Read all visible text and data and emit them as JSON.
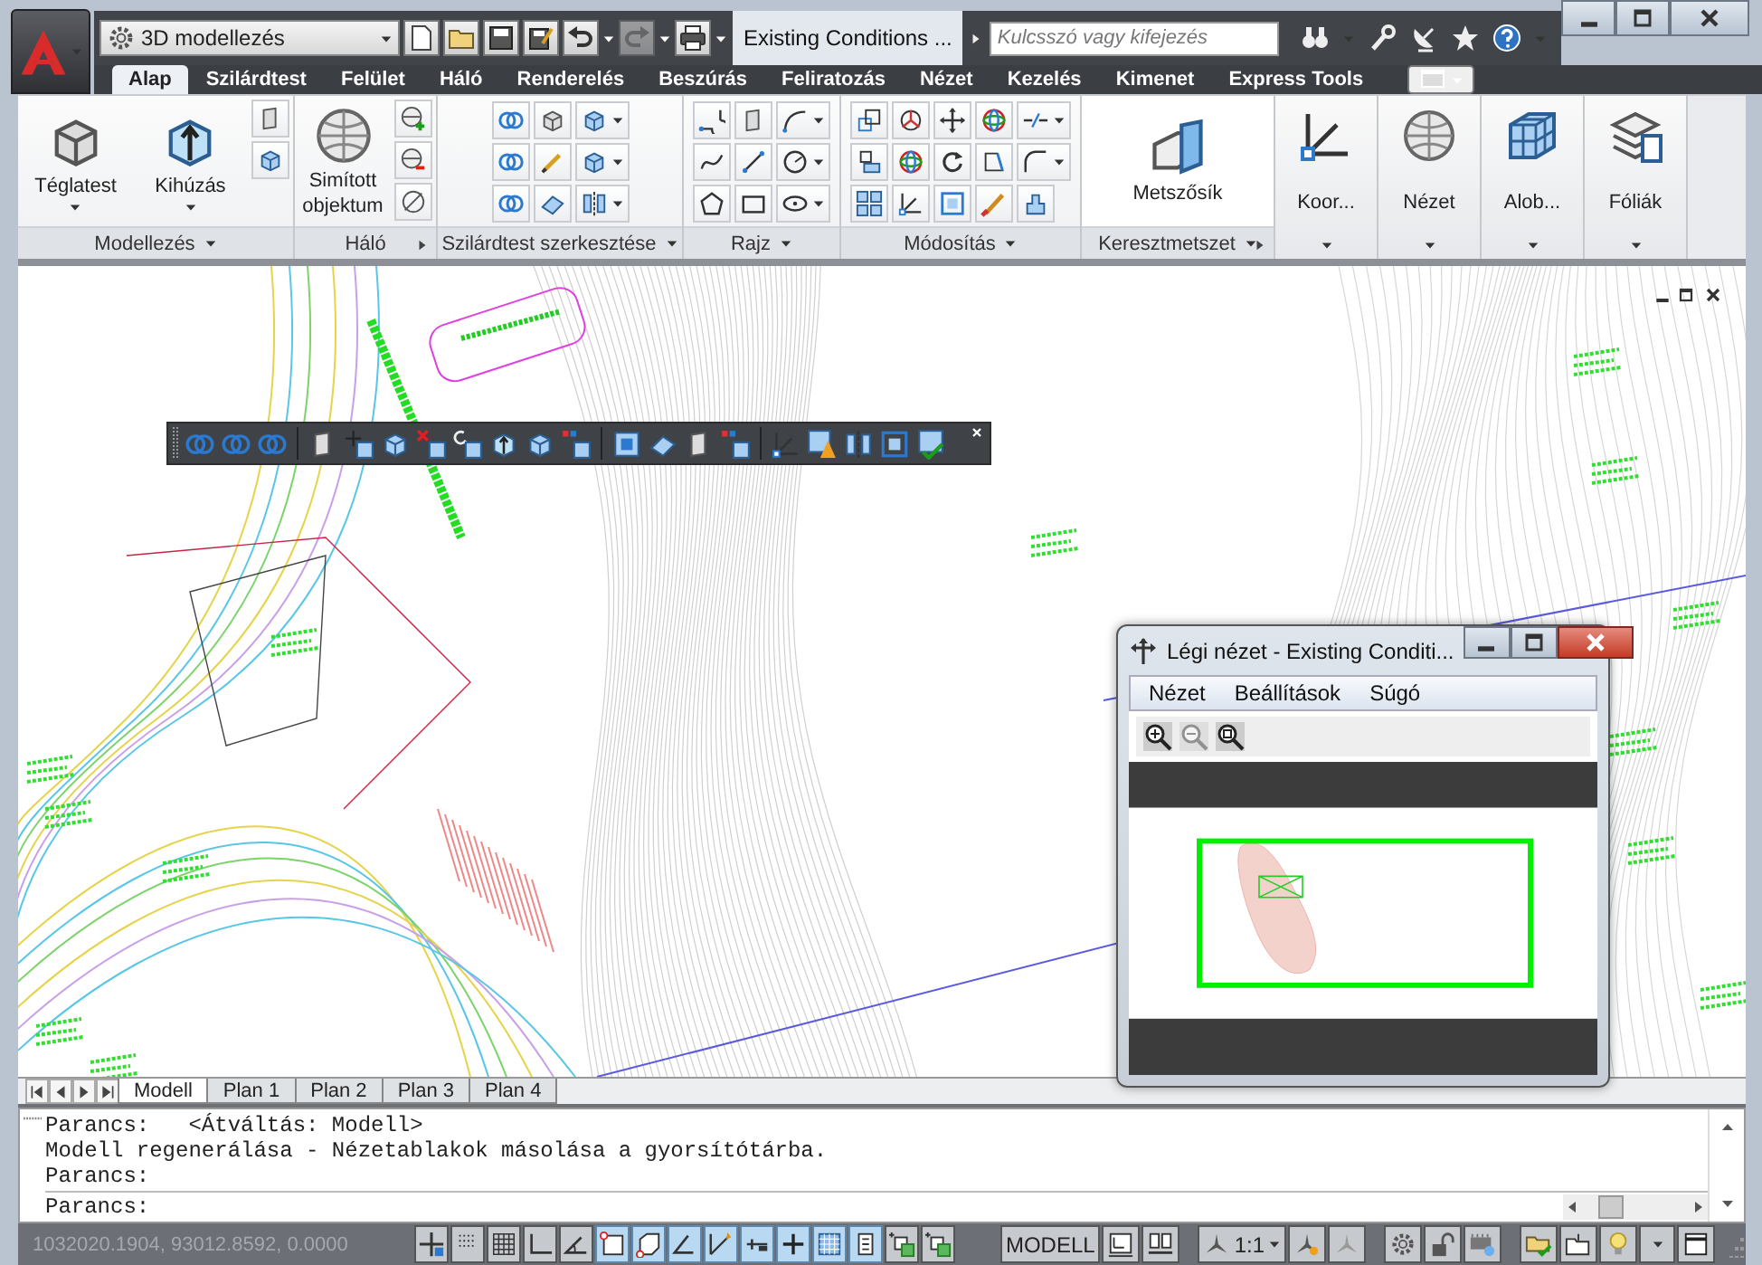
{
  "quick_access": {
    "workspace": "3D modellezés"
  },
  "window": {
    "title": "Existing Conditions ..."
  },
  "search": {
    "placeholder": "Kulcsszó vagy kifejezés"
  },
  "ribbon_tabs": [
    {
      "label": "Alap",
      "selected": true
    },
    {
      "label": "Szilárdtest",
      "selected": false
    },
    {
      "label": "Felület",
      "selected": false
    },
    {
      "label": "Háló",
      "selected": false
    },
    {
      "label": "Renderelés",
      "selected": false
    },
    {
      "label": "Beszúrás",
      "selected": false
    },
    {
      "label": "Feliratozás",
      "selected": false
    },
    {
      "label": "Nézet",
      "selected": false
    },
    {
      "label": "Kezelés",
      "selected": false
    },
    {
      "label": "Kimenet",
      "selected": false
    },
    {
      "label": "Express Tools",
      "selected": false
    }
  ],
  "ribbon_panels": [
    {
      "kind": "modeling",
      "title": "Modellezés",
      "title_menu": true,
      "launcher": false,
      "tools": [
        {
          "label": "Téglatest",
          "dropdown": true
        },
        {
          "label": "Kihúzás",
          "dropdown": true
        }
      ]
    },
    {
      "kind": "mesh",
      "title": "Háló",
      "title_menu": false,
      "launcher": true,
      "tools": [
        {
          "label": "Simított objektum",
          "dropdown": false
        }
      ]
    },
    {
      "kind": "solid-edit",
      "title": "Szilárdtest szerkesztése",
      "title_menu": true,
      "launcher": false
    },
    {
      "kind": "draw",
      "title": "Rajz",
      "title_menu": true,
      "launcher": false
    },
    {
      "kind": "modify",
      "title": "Módosítás",
      "title_menu": true,
      "launcher": false
    },
    {
      "kind": "section",
      "title": "Keresztmetszet",
      "title_menu": true,
      "launcher": true,
      "tools": [
        {
          "label": "Metszősík",
          "dropdown": false
        }
      ]
    },
    {
      "kind": "collapsed",
      "label": "Koor..."
    },
    {
      "kind": "collapsed",
      "label": "Nézet"
    },
    {
      "kind": "collapsed",
      "label": "Alob..."
    },
    {
      "kind": "collapsed",
      "label": "Fóliák"
    }
  ],
  "aerial_view": {
    "title": "Légi nézet - Existing Conditi...",
    "menu": [
      "Nézet",
      "Beállítások",
      "Súgó"
    ],
    "tools": [
      {
        "disabled": false
      },
      {
        "disabled": true
      },
      {
        "disabled": false
      }
    ]
  },
  "layout_tabs": [
    {
      "label": "Modell",
      "selected": true
    },
    {
      "label": "Plan 1",
      "selected": false
    },
    {
      "label": "Plan 2",
      "selected": false
    },
    {
      "label": "Plan 3",
      "selected": false
    },
    {
      "label": "Plan 4",
      "selected": false
    }
  ],
  "command_history": [
    "Parancs:   <Átváltás: Modell>",
    "Modell regenerálása - Nézetablakok másolása a gyorsítótárba.",
    "Parancs:"
  ],
  "command_prompt": "Parancs:",
  "status_bar": {
    "coordinates": "1032020.1904, 93012.8592, 0.0000",
    "toggles": [
      {
        "on": false
      },
      {
        "on": false
      },
      {
        "on": false
      },
      {
        "on": false
      },
      {
        "on": false
      },
      {
        "on": true
      },
      {
        "on": true
      },
      {
        "on": true
      },
      {
        "on": true
      },
      {
        "on": true
      },
      {
        "on": true
      },
      {
        "on": true
      },
      {
        "on": true
      },
      {
        "on": false
      },
      {
        "on": false
      }
    ],
    "space": "MODELL",
    "annotation_scale": "1:1"
  }
}
